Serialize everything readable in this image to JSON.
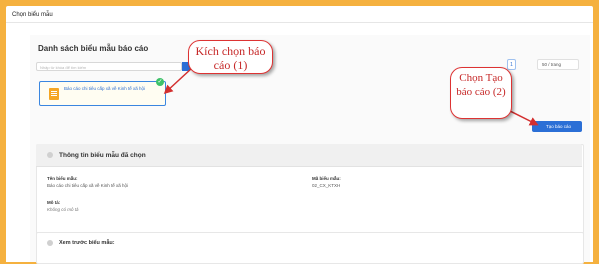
{
  "window": {
    "title": "Chọn biểu mẫu"
  },
  "list": {
    "title": "Danh sách biểu mẫu báo cáo",
    "search_placeholder": "Nhập từ khóa để tìm kiếm"
  },
  "card": {
    "label": "Báo cáo chi tiêu cấp xã về Kinh tế xã hội"
  },
  "pagination": {
    "current_page": "1",
    "per_page": "50 / trang"
  },
  "create_button": {
    "label": "Tạo báo cáo"
  },
  "callouts": {
    "step1": "Kích chọn báo cáo (1)",
    "step2": "Chọn Tạo báo cáo (2)"
  },
  "info": {
    "title": "Thông tin biểu mẫu đã chọn",
    "name_label": "Tên biểu mẫu:",
    "name_value": "Báo cáo chi tiêu cấp xã về Kinh tế xã hội",
    "code_label": "Mã biểu mẫu:",
    "code_value": "02_CX_KTXH",
    "desc_label": "Mô tả:",
    "desc_value": "Không có mô tả"
  },
  "preview": {
    "label": "Xem trước biểu mẫu:"
  },
  "colors": {
    "frame": "#f5b13f",
    "accent": "#2b6fd6",
    "callout": "#c62828"
  }
}
